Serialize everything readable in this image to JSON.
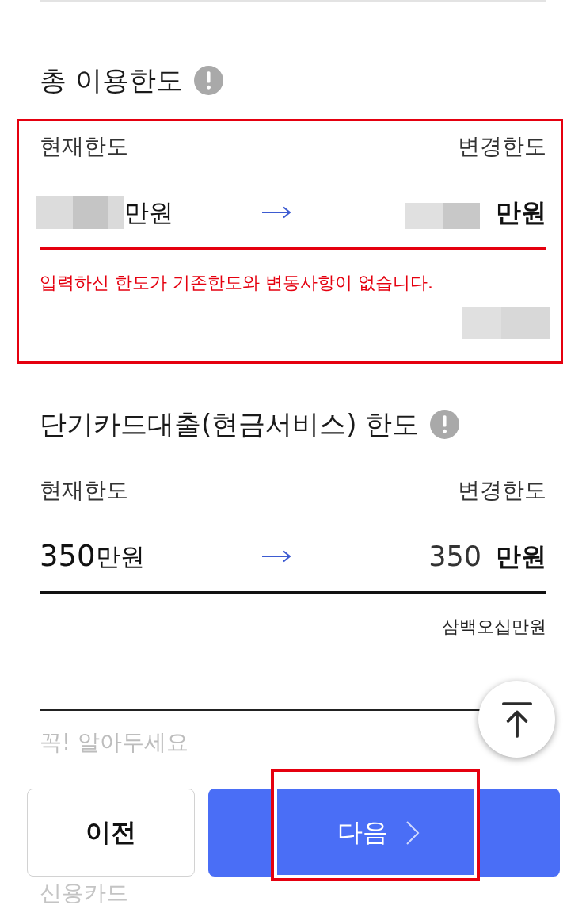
{
  "sections": [
    {
      "title": "총 이용한도",
      "highlighted": true,
      "current_label": "현재한도",
      "new_label": "변경한도",
      "current": {
        "redacted": true,
        "unit": "만원"
      },
      "new": {
        "redacted": true,
        "unit": "만원"
      },
      "error": true,
      "message": "입력하신 한도가 기존한도와 변동사항이 없습니다.",
      "amount_in_words": {
        "redacted": true
      }
    },
    {
      "title": "단기카드대출(현금서비스) 한도",
      "highlighted": false,
      "current_label": "현재한도",
      "new_label": "변경한도",
      "current": {
        "redacted": false,
        "amount": "350",
        "unit": "만원"
      },
      "new": {
        "redacted": false,
        "amount": "350",
        "unit": "만원"
      },
      "error": false,
      "amount_in_words": {
        "redacted": false,
        "text": "삼백오십만원"
      }
    }
  ],
  "notice": {
    "heading": "꼭! 알아두세요",
    "items": [
      "신용카드"
    ]
  },
  "buttons": [
    {
      "label": "이전",
      "kind": "secondary",
      "highlighted": false
    },
    {
      "label": "다음",
      "kind": "primary",
      "highlighted": true
    }
  ]
}
